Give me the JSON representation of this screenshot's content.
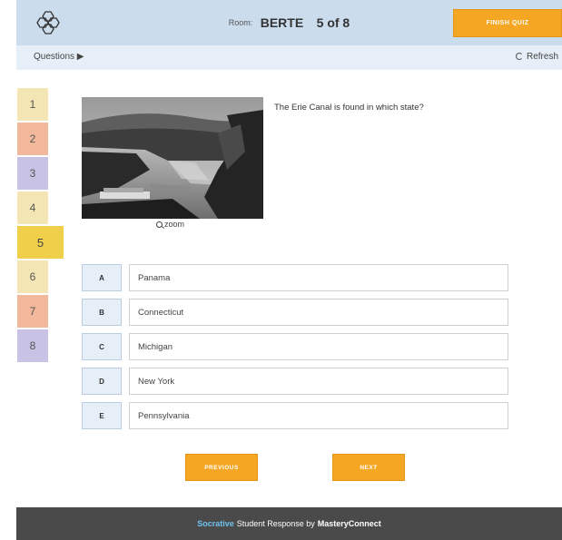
{
  "header": {
    "room_label": "Room:",
    "room_name": "BERTE",
    "progress": "5 of 8",
    "finish_label": "FINISH QUIZ",
    "logo_icon": "hexagon-logo-icon"
  },
  "subbar": {
    "questions_label": "Questions ▶",
    "refresh_label": "Refresh"
  },
  "question_nav": [
    {
      "label": "1",
      "color": "#f4e6b4"
    },
    {
      "label": "2",
      "color": "#f1b89b"
    },
    {
      "label": "3",
      "color": "#c8c2e4"
    },
    {
      "label": "4",
      "color": "#f4e6b4"
    },
    {
      "label": "5",
      "color": "#f0cf4a",
      "current": true
    },
    {
      "label": "6",
      "color": "#f4e6b4"
    },
    {
      "label": "7",
      "color": "#f1b89b"
    },
    {
      "label": "8",
      "color": "#c8c2e4"
    }
  ],
  "question": {
    "text": "The Erie Canal is found in which state?",
    "zoom_label": "zoom"
  },
  "answers": [
    {
      "letter": "A",
      "text": "Panama"
    },
    {
      "letter": "B",
      "text": "Connecticut"
    },
    {
      "letter": "C",
      "text": "Michigan"
    },
    {
      "letter": "D",
      "text": "New York"
    },
    {
      "letter": "E",
      "text": "Pennsylvania"
    }
  ],
  "buttons": {
    "previous": "PREVIOUS",
    "next": "NEXT"
  },
  "footer": {
    "brand": "Socrative",
    "middle": "Student Response by",
    "company": "MasteryConnect"
  },
  "colors": {
    "accent": "#f5a623",
    "header_bg": "#cbdcec",
    "subbar_bg": "#e6eef7",
    "footer_bg": "#4a4a4a"
  }
}
